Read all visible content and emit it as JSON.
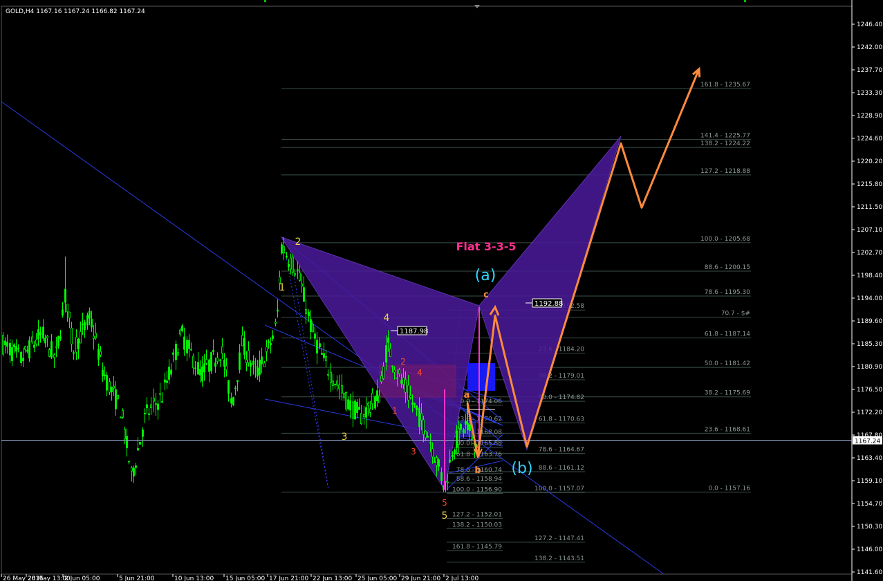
{
  "window": {
    "symbol_info": "GOLD,H4  1167.16 1167.24 1166.82 1167.24",
    "current_price_label": "1167.24"
  },
  "colors": {
    "background": "#000000",
    "bull_candle": "#00ff00",
    "bear_candle": "#00ff00",
    "price_line": "#8ea0c8",
    "trend_line": "#2b3ff0",
    "fib_line": "#3b4f4b",
    "fib_text": "#8b9a95",
    "pattern_fill": "#4a1a9a",
    "projection": "#ff8a3d",
    "wave_cyan": "#33d6ff",
    "wave_yellow": "#e8d34a",
    "wave_red": "#ff4a2a",
    "magenta": "#ff33cc",
    "title_pink": "#ff2f8f"
  },
  "chart_data": {
    "type": "candlestick",
    "title": "",
    "ylim": [
      1141.6,
      1248.2
    ],
    "price_axis_ticks": [
      "1246.40",
      "1242.00",
      "1237.70",
      "1233.30",
      "1228.90",
      "1224.60",
      "1220.20",
      "1215.80",
      "1211.50",
      "1207.10",
      "1202.70",
      "1198.40",
      "1194.00",
      "1189.60",
      "1185.30",
      "1180.90",
      "1176.50",
      "1172.20",
      "1167.80",
      "1163.40",
      "1159.10",
      "1154.70",
      "1150.30",
      "1146.00",
      "1141.60"
    ],
    "time_axis_ticks": [
      "26 May 2015",
      "28 May 13:00",
      "2 Jun 05:00",
      "5 Jun 21:00",
      "10 Jun 13:00",
      "15 Jun 05:00",
      "17 Jun 21:00",
      "22 Jun 13:00",
      "25 Jun 05:00",
      "29 Jun 21:00",
      "2 Jul 13:00"
    ],
    "current_price": 1167.24,
    "pattern_label": "Flat 3-3-5",
    "wave_labels": {
      "cyan": [
        "(a)",
        "(b)"
      ],
      "orange": [
        "a",
        "b",
        "c"
      ],
      "yellow": [
        "1",
        "2",
        "3",
        "4",
        "5"
      ],
      "red": [
        "1",
        "2",
        "3",
        "4",
        "5"
      ]
    },
    "price_boxes": [
      "1187.98",
      "1192.88"
    ],
    "fib_levels_right": [
      {
        "label": "161.8 - 1235.67",
        "price": 1235.67
      },
      {
        "label": "141.4 - 1225.77",
        "price": 1225.77
      },
      {
        "label": "138.2 - 1224.22",
        "price": 1224.22
      },
      {
        "label": "127.2 - 1218.88",
        "price": 1218.88
      },
      {
        "label": "100.0 - 1205.68",
        "price": 1205.68
      },
      {
        "label": "88.6 - 1200.15",
        "price": 1200.15
      },
      {
        "label": "78.6 - 1195.30",
        "price": 1195.3
      },
      {
        "label": "70.7 - $#",
        "price": 1191.2
      },
      {
        "label": "61.8 - 1187.14",
        "price": 1187.14
      },
      {
        "label": "50.0 - 1181.42",
        "price": 1181.42
      },
      {
        "label": "38.2 - 1175.69",
        "price": 1175.69
      },
      {
        "label": "23.6 - 1168.61",
        "price": 1168.61
      },
      {
        "label": "0.0 - 1157.16",
        "price": 1157.16
      }
    ],
    "fib_levels_mid": [
      {
        "label": "0.0 - 1192.58",
        "price": 1192.58
      },
      {
        "label": "23.6 - 1184.20",
        "price": 1184.2
      },
      {
        "label": "38.2 - 1179.01",
        "price": 1179.01
      },
      {
        "label": "50.0 - 1174.82",
        "price": 1174.82
      },
      {
        "label": "61.8 - 1170.63",
        "price": 1170.63
      },
      {
        "label": "78.6 - 1164.67",
        "price": 1164.67
      },
      {
        "label": "88.6 - 1161.12",
        "price": 1161.12
      },
      {
        "label": "100.0 - 1157.07",
        "price": 1157.07
      },
      {
        "label": "127.2 - 1147.41",
        "price": 1147.41
      },
      {
        "label": "138.2 - 1143.51",
        "price": 1143.51
      }
    ],
    "fib_levels_left": [
      {
        "label": "0.0 - 1174.06",
        "price": 1174.06
      },
      {
        "label": "23.6 - 1170.62",
        "price": 1170.62
      },
      {
        "label": "38.2 - 1168.08",
        "price": 1168.08
      },
      {
        "label": "50.0 - 1165.88",
        "price": 1165.88
      },
      {
        "label": "61.8 - 1163.76",
        "price": 1163.76
      },
      {
        "label": "78.6 - 1160.74",
        "price": 1160.74
      },
      {
        "label": "88.6 - 1158.94",
        "price": 1158.94
      },
      {
        "label": "100.0 - 1156.90",
        "price": 1156.9
      },
      {
        "label": "127.2 - 1152.01",
        "price": 1152.01
      },
      {
        "label": "138.2 - 1150.03",
        "price": 1150.03
      },
      {
        "label": "161.8 - 1145.79",
        "price": 1145.79
      }
    ],
    "projection_path": [
      {
        "bar": 1,
        "price": 1174.5
      },
      {
        "bar": 2,
        "price": 1164.0
      },
      {
        "bar": 3,
        "price": 1191.5
      },
      {
        "bar": 4,
        "price": 1166.0
      },
      {
        "bar": 5,
        "price": 1225.0
      },
      {
        "bar": 6,
        "price": 1212.5
      },
      {
        "bar": 7,
        "price": 1239.5
      }
    ]
  }
}
